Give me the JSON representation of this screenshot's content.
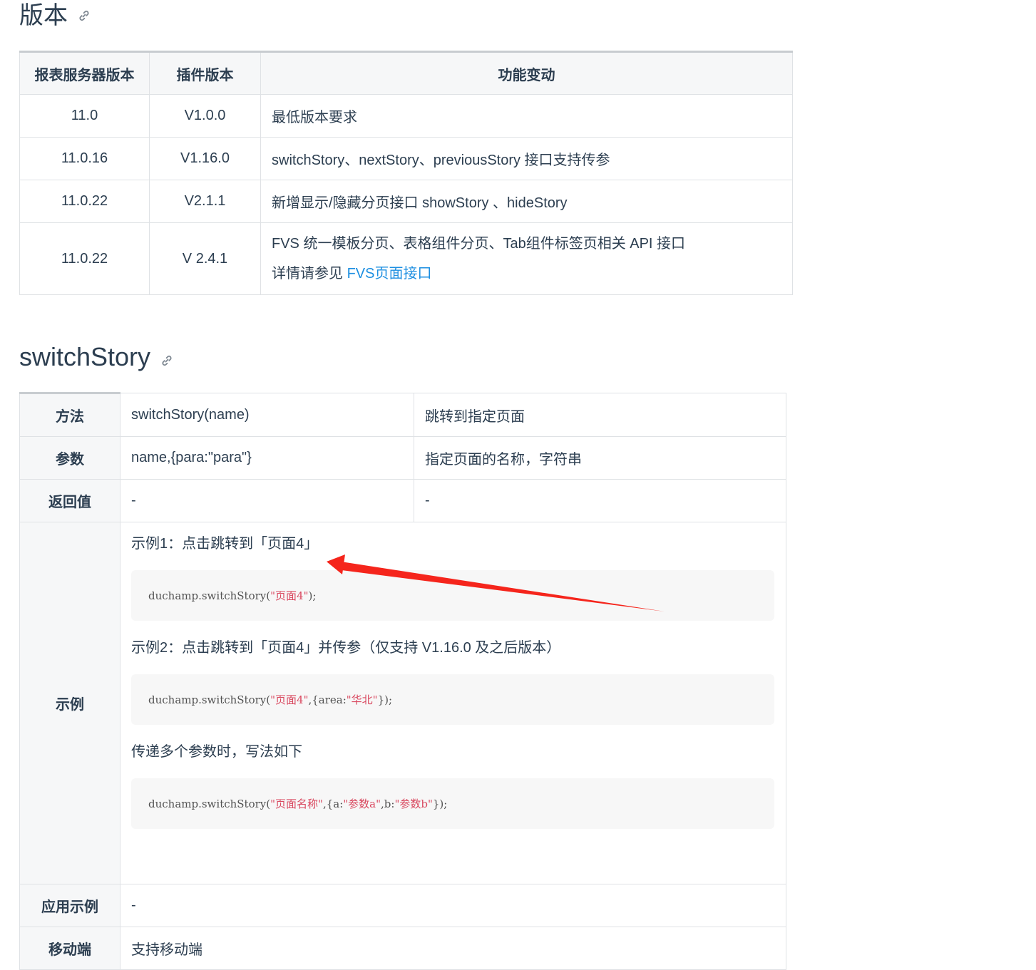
{
  "version_section": {
    "title": "版本",
    "headers": [
      "报表服务器版本",
      "插件版本",
      "功能变动"
    ],
    "rows": [
      {
        "server": "11.0",
        "plugin": "V1.0.0",
        "change": "最低版本要求"
      },
      {
        "server": "11.0.16",
        "plugin": "V1.16.0",
        "change": "switchStory、nextStory、previousStory 接口支持传参"
      },
      {
        "server": "11.0.22",
        "plugin": "V2.1.1",
        "change": "新增显示/隐藏分页接口 showStory 、hideStory"
      },
      {
        "server": "11.0.22",
        "plugin": "V 2.4.1",
        "change": "FVS 统一模板分页、表格组件分页、Tab组件标签页相关 API 接口",
        "change_line2_prefix": "详情请参见 ",
        "change_link": "FVS页面接口"
      }
    ]
  },
  "switch_section": {
    "title": "switchStory",
    "method": {
      "label": "方法",
      "signature": "switchStory(name)",
      "desc": "跳转到指定页面"
    },
    "params": {
      "label": "参数",
      "signature": "name,{para:\"para\"}",
      "desc": "指定页面的名称，字符串"
    },
    "return": {
      "label": "返回值",
      "signature": "-",
      "desc": "-"
    },
    "example": {
      "label": "示例",
      "ex1_text": "示例1：点击跳转到「页面4」",
      "ex1_code_prefix": "duchamp.switchStory(",
      "ex1_code_str": "\"页面4\"",
      "ex1_code_suffix": ");",
      "ex2_text": "示例2：点击跳转到「页面4」并传参（仅支持 V1.16.0 及之后版本）",
      "ex2_code_prefix": "duchamp.switchStory(",
      "ex2_code_str1": "\"页面4\"",
      "ex2_code_mid": ",{area:",
      "ex2_code_str2": "\"华北\"",
      "ex2_code_suffix": "});",
      "ex3_text": "传递多个参数时，写法如下",
      "ex3_code_prefix": "duchamp.switchStory(",
      "ex3_code_str1": "\"页面名称\"",
      "ex3_code_mid1": ",{a:",
      "ex3_code_str2": "\"参数a\"",
      "ex3_code_mid2": ",b:",
      "ex3_code_str3": "\"参数b\"",
      "ex3_code_suffix": "});"
    },
    "app_example": {
      "label": "应用示例",
      "value": "-"
    },
    "mobile": {
      "label": "移动端",
      "value": "支持移动端"
    }
  },
  "colors": {
    "link": "#1d8fe1",
    "code_string": "#d9485f",
    "annotation_arrow": "#f5251c"
  },
  "icons": [
    "link-icon",
    "annotation-arrow"
  ]
}
